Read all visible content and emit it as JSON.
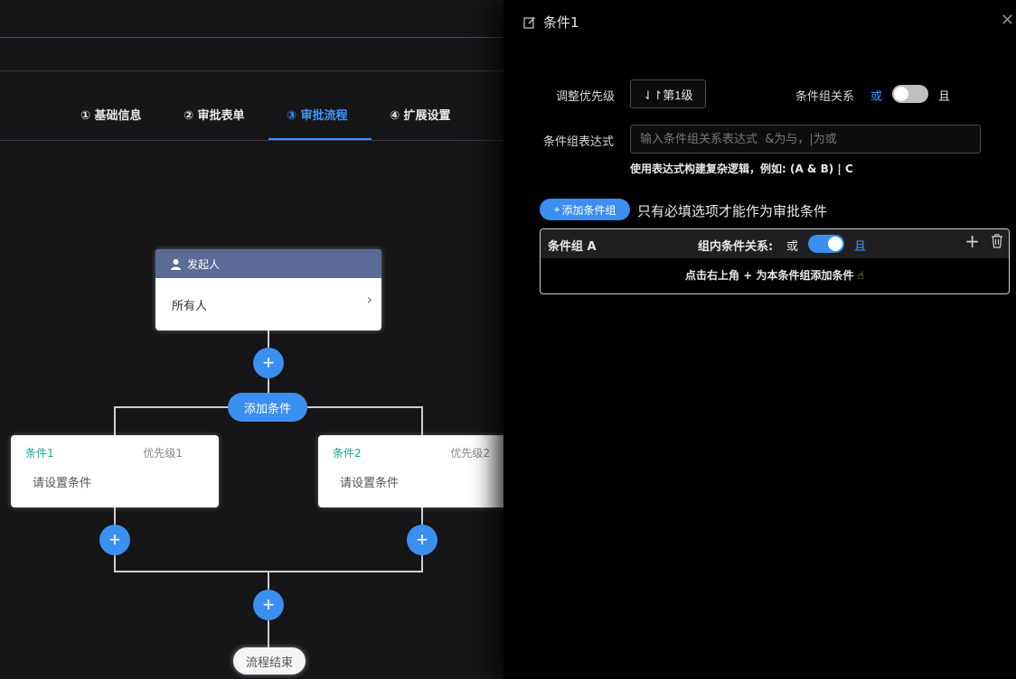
{
  "steps": [
    {
      "label": "① 基础信息"
    },
    {
      "label": "② 审批表单"
    },
    {
      "label": "③ 审批流程"
    },
    {
      "label": "④ 扩展设置"
    }
  ],
  "flow": {
    "start_title": "发起人",
    "start_value": "所有人",
    "add_condition_label": "添加条件",
    "conditions": [
      {
        "name": "条件1",
        "priority": "优先级1",
        "placeholder": "请设置条件"
      },
      {
        "name": "条件2",
        "priority": "优先级2",
        "placeholder": "请设置条件"
      }
    ],
    "end_label": "流程结束"
  },
  "drawer": {
    "title": "条件1",
    "priority_label": "调整优先级",
    "priority_value": "⇃↾第1级",
    "relation_label": "条件组关系",
    "relation_or": "或",
    "relation_and": "且",
    "expr_label": "条件组表达式",
    "expr_placeholder": "输入条件组关系表达式  &为与，|为或",
    "expr_hint": "使用表达式构建复杂逻辑，例如: (A & B) | C",
    "add_group_label": "添加条件组",
    "add_group_note": "只有必填选项才能作为审批条件",
    "group": {
      "name": "条件组 A",
      "inner_label": "组内条件关系:",
      "inner_or": "或",
      "inner_and": "且",
      "empty_text": "点击右上角 + 为本条件组添加条件"
    }
  },
  "colors": {
    "accent": "#3b8ff0",
    "condition_name": "#19a38e",
    "start_header": "#5a6b96"
  }
}
